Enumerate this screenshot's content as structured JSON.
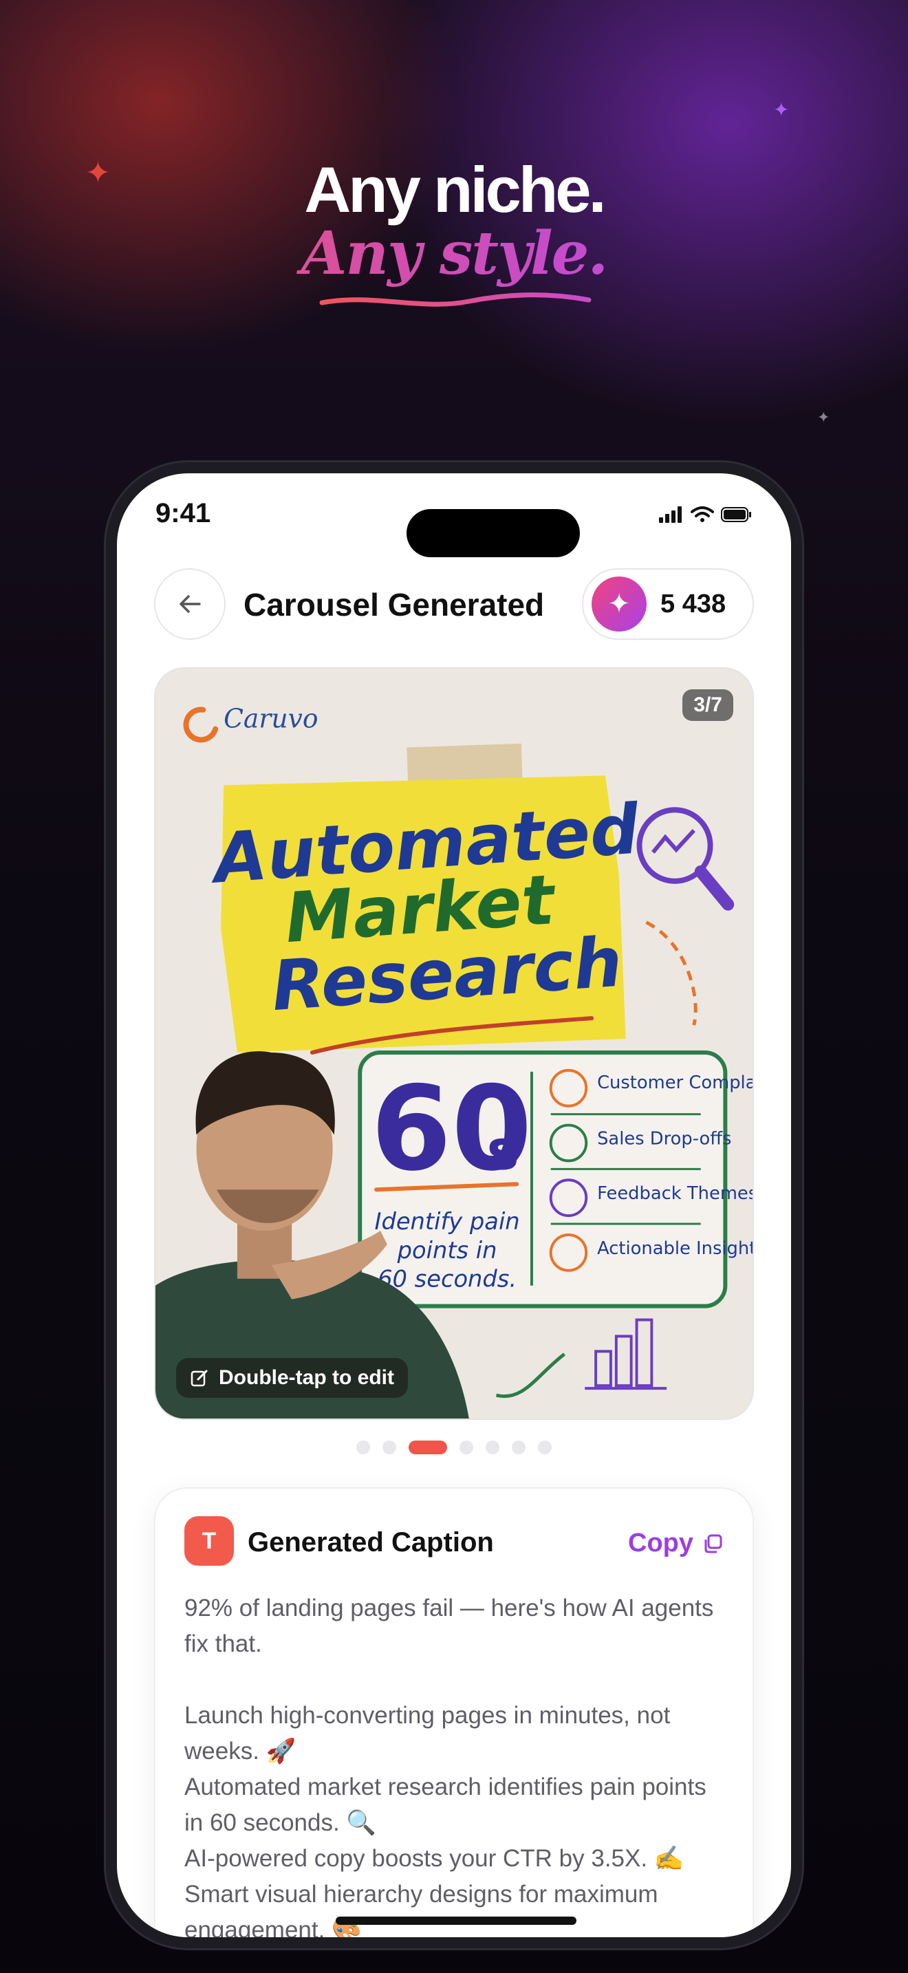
{
  "hero": {
    "headline": "Any niche.",
    "subline": "Any style."
  },
  "status_bar": {
    "time": "9:41"
  },
  "header": {
    "title": "Carousel Generated",
    "credits": "5 438"
  },
  "slide": {
    "counter": "3/7",
    "edit_hint": "Double-tap to edit",
    "brand": "Caruvo",
    "heading": [
      "Automated",
      "Market",
      "Research"
    ],
    "stat_value": "60",
    "stat_unit": "s",
    "stat_caption": [
      "Identify pain",
      "points in",
      "60 seconds."
    ],
    "features": [
      "Customer Complaints",
      "Sales Drop-offs",
      "Feedback Themes",
      "Actionable Insights"
    ]
  },
  "pagination": {
    "total": 7,
    "active_index": 2
  },
  "caption": {
    "icon_letter": "T",
    "title": "Generated Caption",
    "copy_label": "Copy",
    "lines": [
      "92% of landing pages fail — here's how AI agents fix that.",
      "",
      "Launch high-converting pages in minutes, not weeks. 🚀",
      "Automated market research identifies pain points in 60 seconds. 🔍",
      "AI-powered copy boosts your CTR by 3.5X. ✍️",
      "Smart visual hierarchy designs for maximum engagement. 🎨"
    ]
  },
  "colors": {
    "accent_red": "#f0554a",
    "accent_purple": "#9b3de6"
  }
}
